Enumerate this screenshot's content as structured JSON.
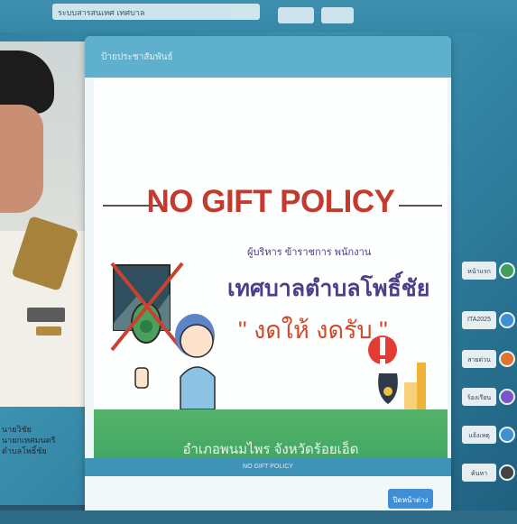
{
  "top": {
    "title": "ระบบสารสนเทศ เทศบาล"
  },
  "left": {
    "name_lines": [
      "นายวิชัย",
      "นายกเทศมนตรี",
      "ตำบลโพธิ์ชัย"
    ]
  },
  "modal": {
    "header_title": "ป้ายประชาสัมพันธ์",
    "poster": {
      "headline": "NO GIFT POLICY",
      "audience": "ผู้บริหาร ข้าราชการ พนักงาน",
      "org": "เทศบาลตำบลโพธิ์ชัย",
      "slogan": "\" งดให้ งดรับ \"",
      "district": "อำเภอพนมไพร จังหวัดร้อยเอ็ด"
    },
    "caption": "NO GIFT POLICY",
    "close_label": "ปิดหน้าต่าง"
  },
  "side_menu": [
    {
      "label": "หน้าแรก",
      "color": "#3f9e5a",
      "icon": "home-icon"
    },
    {
      "label": "ITA2025",
      "color": "#3f8fd6",
      "icon": "info-icon"
    },
    {
      "label": "สายด่วน",
      "color": "#e0742e",
      "icon": "phone-icon"
    },
    {
      "label": "ร้องเรียน",
      "color": "#7a55c8",
      "icon": "chat-icon"
    },
    {
      "label": "แจ้งเหตุ",
      "color": "#3f8fd6",
      "icon": "alert-icon"
    },
    {
      "label": "ค้นหา",
      "color": "#444444",
      "icon": "search-icon"
    }
  ]
}
